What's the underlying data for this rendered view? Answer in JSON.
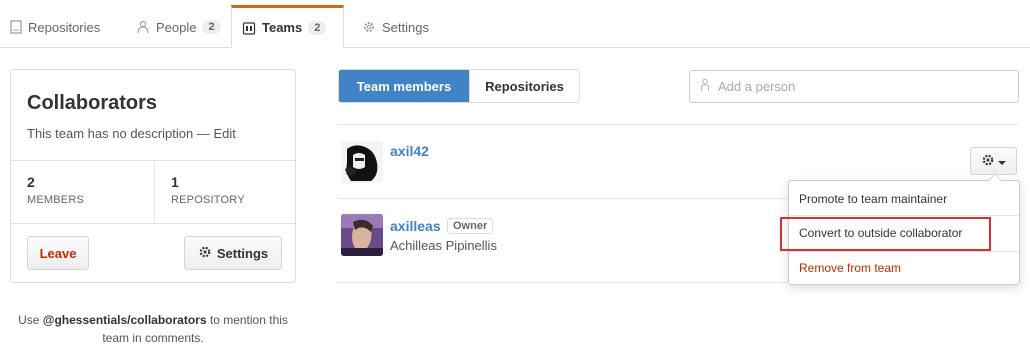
{
  "tabs": [
    {
      "label": "Repositories",
      "icon": "repo-icon"
    },
    {
      "label": "People",
      "count": "2",
      "icon": "people-icon"
    },
    {
      "label": "Teams",
      "count": "2",
      "icon": "teams-icon",
      "selected": true
    },
    {
      "label": "Settings",
      "icon": "gear-icon"
    }
  ],
  "sidebar": {
    "title": "Collaborators",
    "description": "This team has no description —",
    "edit_label": "Edit",
    "stats": [
      {
        "value": "2",
        "label": "MEMBERS"
      },
      {
        "value": "1",
        "label": "REPOSITORY"
      }
    ],
    "leave_label": "Leave",
    "settings_label": "Settings",
    "mention_prefix": "Use",
    "mention_handle": "@ghessentials/collaborators",
    "mention_suffix": "to mention this team in comments."
  },
  "main": {
    "segments": [
      "Team members",
      "Repositories"
    ],
    "add_person_placeholder": "Add a person",
    "members": [
      {
        "username": "axil42",
        "full_name": "",
        "badge": ""
      },
      {
        "username": "axilleas",
        "full_name": "Achilleas Pipinellis",
        "badge": "Owner"
      }
    ],
    "dropdown": [
      {
        "label": "Promote to team maintainer"
      },
      {
        "label": "Convert to outside collaborator"
      },
      {
        "label": "Remove from team"
      }
    ]
  },
  "colors": {
    "accent": "#4183c4",
    "tab_highlight": "#d26911",
    "danger": "#bd2c00",
    "annotation_box": "#d9302e"
  }
}
